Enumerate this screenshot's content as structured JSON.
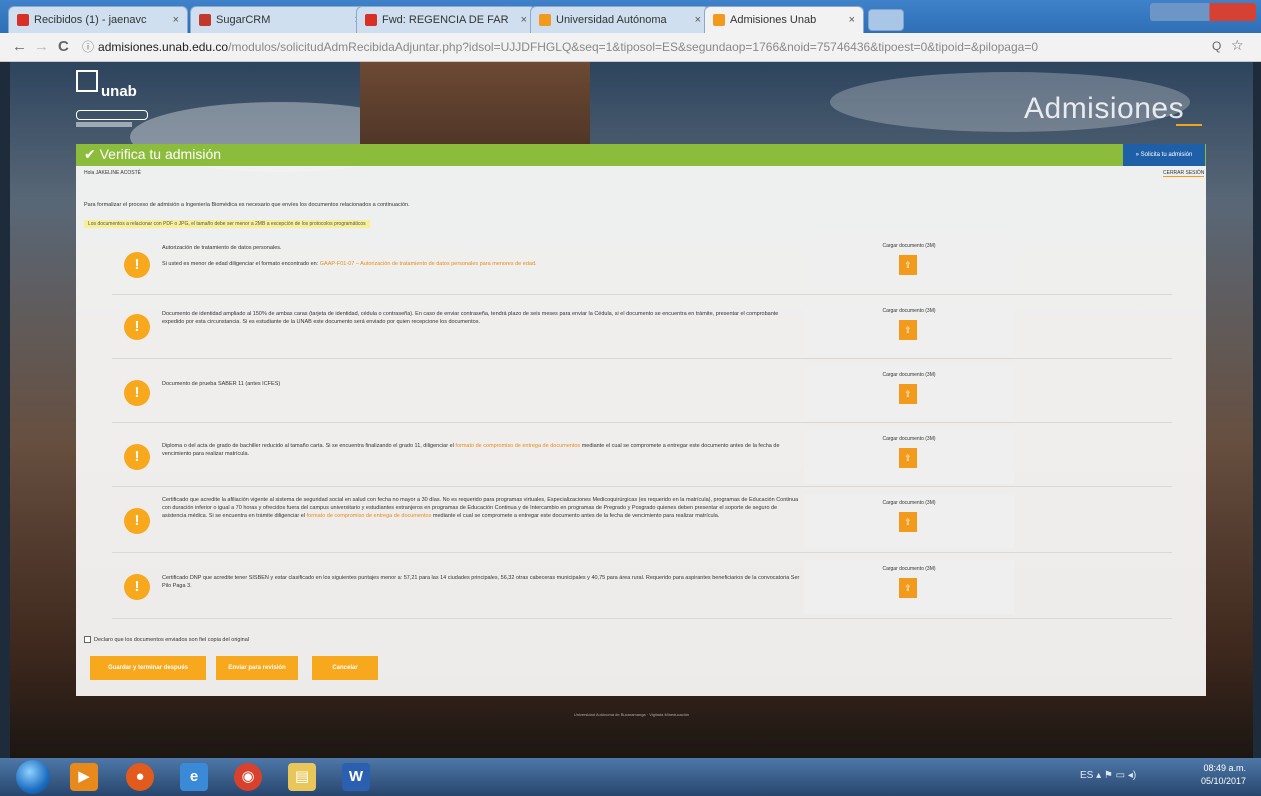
{
  "browser": {
    "tabs": [
      {
        "label": "Recibidos (1) - jaenavc",
        "favicon_color": "#d93025"
      },
      {
        "label": "SugarCRM",
        "favicon_color": "#c0392b"
      },
      {
        "label": "Fwd: REGENCIA DE FAR",
        "favicon_color": "#d93025"
      },
      {
        "label": "Universidad Autónoma",
        "favicon_color": "#f29a1c"
      },
      {
        "label": "Admisiones Unab",
        "favicon_color": "#f29a1c"
      }
    ],
    "tab_close": "×",
    "back_icon": "←",
    "forward_icon": "→",
    "reload_icon": "C",
    "url_host": "admisiones.unab.edu.co",
    "url_path": "/modulos/solicitudAdmRecibidaAdjuntar.php?idsol=UJJDFHGLQ&seq=1&tiposol=ES&segundaop=1766&noid=75746436&tipoest=0&tipoid=&pilopaga=0",
    "zoom_icon": "Q",
    "star_icon": "☆"
  },
  "site": {
    "logo_text": "unab",
    "brand": "Admisiones",
    "header_title": "✔ Verifica tu admisión",
    "header_button": "» Solicita tu admisión",
    "user_label": "Hola JAKELINE ACOSTÉ",
    "logout_label": "CERRAR SESIÓN",
    "intro": "Para formalizar el proceso de admisión a Ingeniería Biomédica es necesario que envíes los documentos relacionados a continuación.",
    "note": "Los documentos a relacionar con PDF o JPG, el tamaño debe ser menor a 2MB a excepción de los protocolos programáticos",
    "upload_label": "Cargar documento (3M)",
    "upload_icon": "⇪",
    "warn_icon": "!",
    "requirements": [
      {
        "text": "Autorización de tratamiento de datos personales.",
        "text2": "Si usted es menor de edad diligenciar el formato encontrado en: ",
        "link": "GAAP-F01-07 – Autorización de tratamiento de datos personales para menores de edad."
      },
      {
        "text": "Documento de identidad ampliado al 150% de ambas caras (tarjeta de identidad, cédula o contraseña). En caso de enviar contraseña, tendrá plazo de seis meses para enviar la Cédula, si el documento se encuentra en trámite, presentar el comprobante expedido por esta circunstancia. Si es estudiante de la UNAB este documento será enviado por quien recepcione los documentos.",
        "text2": "",
        "link": ""
      },
      {
        "text": "Documento de prueba SABER 11 (antes ICFES)",
        "text2": "",
        "link": ""
      },
      {
        "text": "Diploma o del acta de grado de bachiller reducido al tamaño carta. Si se encuentra finalizando el grado 11, diligenciar el ",
        "text2": " mediante el cual se compromete a entregar este documento antes de la fecha de vencimiento para realizar matrícula.",
        "link": "formato de compromiso de entrega de documentos"
      },
      {
        "text": "Certificado que acredite la afiliación vigente al sistema de seguridad social en salud con fecha no mayor a 30 días. No es requerido para programas virtuales, Especializaciones Medicoquirúrgicas (es requerido en la matrícula), programas de Educación Continua con duración inferior o igual a 70 horas y ofrecidos fuera del campus universitario y estudiantes extranjeros en programas de Educación Continua y de Intercambio en programas de Pregrado y Posgrado quienes deben presentar el soporte de seguro de asistencia médica. Si se encuentra en trámite diligenciar el ",
        "text2": " mediante el cual se compromete a entregar este documento antes de la fecha de vencimiento para realizar matrícula.",
        "link": "formato de compromiso de entrega de documentos"
      },
      {
        "text": "Certificado DNP que acredite tener SISBEN y estar clasificado en los siguientes puntajes menor a: 57,21 para las 14 ciudades principales, 56,32 otras cabeceras municipales y 40,75 para área rural. Requerido para aspirantes beneficiarios de la convocatoria Ser Pilo Paga 3.",
        "text2": "",
        "link": ""
      }
    ],
    "declaration": "Declaro que los documentos enviados son fiel copia del original",
    "buttons": [
      "Guardar y terminar después",
      "Enviar para revisión",
      "Cancelar"
    ],
    "footer": "Universidad Autónoma de Bucaramanga · Vigilada Mineducación"
  },
  "taskbar": {
    "icons": [
      {
        "label": "▶",
        "color": "#e8891c"
      },
      {
        "label": "●",
        "color": "#e25b1c"
      },
      {
        "label": "e",
        "color": "#3a8ad8"
      },
      {
        "label": "◉",
        "color": "#d9412c"
      },
      {
        "label": "▤",
        "color": "#e8c65a"
      },
      {
        "label": "W",
        "color": "#2b5fb0"
      }
    ],
    "tray": "ES  ▴  ⚑ ▭ ◂)",
    "time": "08:49 a.m.",
    "date": "05/10/2017"
  }
}
